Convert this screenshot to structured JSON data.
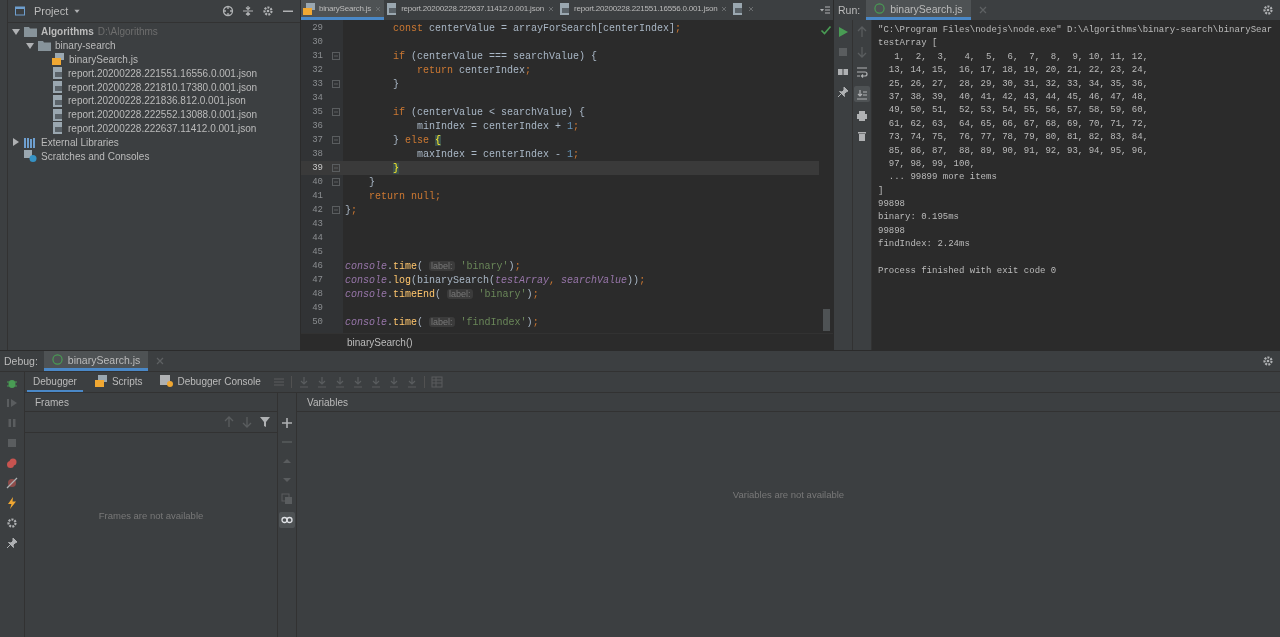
{
  "project": {
    "title": "Project",
    "tree": [
      {
        "name": "Algorithms",
        "hint": "D:\\Algorithms",
        "kind": "folder",
        "expanded": true,
        "children": [
          {
            "name": "binary-search",
            "kind": "folder",
            "expanded": true,
            "children": [
              {
                "name": "binarySearch.js",
                "kind": "js"
              },
              {
                "name": "report.20200228.221551.16556.0.001.json",
                "kind": "json"
              },
              {
                "name": "report.20200228.221810.17380.0.001.json",
                "kind": "json"
              },
              {
                "name": "report.20200228.221836.812.0.001.json",
                "kind": "json"
              },
              {
                "name": "report.20200228.222552.13088.0.001.json",
                "kind": "json"
              },
              {
                "name": "report.20200228.222637.11412.0.001.json",
                "kind": "json"
              }
            ]
          }
        ]
      },
      {
        "name": "External Libraries",
        "kind": "library",
        "expanded": false
      },
      {
        "name": "Scratches and Consoles",
        "kind": "scratches"
      }
    ]
  },
  "editor": {
    "tabs": [
      {
        "label": "binarySearch.js",
        "kind": "js",
        "selected": true
      },
      {
        "label": "report.20200228.222637.11412.0.001.json",
        "kind": "json",
        "selected": false
      },
      {
        "label": "report.20200228.221551.16556.0.001.json",
        "kind": "json",
        "selected": false
      },
      {
        "kind": "json",
        "selected": false
      }
    ],
    "lines": [
      {
        "number": "29",
        "current": false,
        "tokens": [
          {
            "kind": "kw",
            "text": "        const"
          },
          {
            "kind": "plain",
            "text": " centerValue = arrayForSearch[centerIndex]"
          },
          {
            "kind": "kw",
            "text": ";"
          }
        ]
      },
      {
        "number": "30",
        "current": false
      },
      {
        "number": "31",
        "fold": true,
        "current": false,
        "tokens": [
          {
            "kind": "kw",
            "text": "        if"
          },
          {
            "kind": "plain",
            "text": " (centerValue === searchValue) {"
          }
        ]
      },
      {
        "number": "32",
        "current": false,
        "tokens": [
          {
            "kind": "kw",
            "text": "            return"
          },
          {
            "kind": "plain",
            "text": " centerIndex"
          },
          {
            "kind": "kw",
            "text": ";"
          }
        ]
      },
      {
        "number": "33",
        "fold": true,
        "current": false,
        "tokens": [
          {
            "kind": "plain",
            "text": "        }"
          }
        ]
      },
      {
        "number": "34",
        "current": false
      },
      {
        "number": "35",
        "fold": true,
        "current": false,
        "tokens": [
          {
            "kind": "kw",
            "text": "        if"
          },
          {
            "kind": "plain",
            "text": " (centerValue < searchValue) {"
          }
        ]
      },
      {
        "number": "36",
        "current": false,
        "tokens": [
          {
            "kind": "plain",
            "text": "            minIndex = centerIndex + "
          },
          {
            "kind": "num",
            "text": "1"
          },
          {
            "kind": "kw",
            "text": ";"
          }
        ]
      },
      {
        "number": "37",
        "fold": true,
        "current": false,
        "tokens": [
          {
            "kind": "plain",
            "text": "        } "
          },
          {
            "kind": "kw",
            "text": "else "
          },
          {
            "kind": "brace",
            "text": "{"
          }
        ]
      },
      {
        "number": "38",
        "current": false,
        "tokens": [
          {
            "kind": "plain",
            "text": "            maxIndex = centerIndex - "
          },
          {
            "kind": "num",
            "text": "1"
          },
          {
            "kind": "kw",
            "text": ";"
          }
        ]
      },
      {
        "number": "39",
        "fold": true,
        "current": true,
        "tokens": [
          {
            "kind": "brace",
            "text": "        }"
          }
        ]
      },
      {
        "number": "40",
        "fold": true,
        "current": false,
        "tokens": [
          {
            "kind": "plain",
            "text": "    }"
          }
        ]
      },
      {
        "number": "41",
        "current": false,
        "tokens": [
          {
            "kind": "kw",
            "text": "    return null;"
          }
        ]
      },
      {
        "number": "42",
        "fold": true,
        "current": false,
        "tokens": [
          {
            "kind": "plain",
            "text": "}"
          },
          {
            "kind": "kw",
            "text": ";"
          }
        ]
      },
      {
        "number": "43",
        "current": false
      },
      {
        "number": "44",
        "current": false
      },
      {
        "number": "45",
        "current": false
      },
      {
        "number": "46",
        "current": false,
        "tokens": [
          {
            "kind": "global",
            "text": "console"
          },
          {
            "kind": "plain",
            "text": "."
          },
          {
            "kind": "fn",
            "text": "time"
          },
          {
            "kind": "plain",
            "text": "( "
          },
          {
            "kind": "hint",
            "text": "label:"
          },
          {
            "kind": "str",
            "text": " 'binary'"
          },
          {
            "kind": "plain",
            "text": ")"
          },
          {
            "kind": "kw",
            "text": ";"
          }
        ]
      },
      {
        "number": "47",
        "current": false,
        "tokens": [
          {
            "kind": "global",
            "text": "console"
          },
          {
            "kind": "plain",
            "text": "."
          },
          {
            "kind": "fn",
            "text": "log"
          },
          {
            "kind": "plain",
            "text": "(binarySearch("
          },
          {
            "kind": "param",
            "text": "testArray"
          },
          {
            "kind": "kw",
            "text": ", "
          },
          {
            "kind": "param",
            "text": "searchValue"
          },
          {
            "kind": "plain",
            "text": "))"
          },
          {
            "kind": "kw",
            "text": ";"
          }
        ]
      },
      {
        "number": "48",
        "current": false,
        "tokens": [
          {
            "kind": "global",
            "text": "console"
          },
          {
            "kind": "plain",
            "text": "."
          },
          {
            "kind": "fn",
            "text": "timeEnd"
          },
          {
            "kind": "plain",
            "text": "( "
          },
          {
            "kind": "hint",
            "text": "label:"
          },
          {
            "kind": "str",
            "text": " 'binary'"
          },
          {
            "kind": "plain",
            "text": ")"
          },
          {
            "kind": "kw",
            "text": ";"
          }
        ]
      },
      {
        "number": "49",
        "current": false
      },
      {
        "number": "50",
        "current": false,
        "tokens": [
          {
            "kind": "global",
            "text": "console"
          },
          {
            "kind": "plain",
            "text": "."
          },
          {
            "kind": "fn",
            "text": "time"
          },
          {
            "kind": "plain",
            "text": "( "
          },
          {
            "kind": "hint",
            "text": "label:"
          },
          {
            "kind": "str",
            "text": " 'findIndex'"
          },
          {
            "kind": "plain",
            "text": ")"
          },
          {
            "kind": "kw",
            "text": ";"
          }
        ]
      }
    ],
    "breadcrumb": "binarySearch()"
  },
  "run": {
    "label": "Run:",
    "tab": "binarySearch.js",
    "output": [
      [
        "\"C:\\Program Files\\nodejs\\node.exe\" D:\\Algorithms\\binary-search\\binarySear",
        "testArray [",
        "   1,  2,  3,   4,  5,  6,  7,  8,  9, 10, 11, 12,",
        "  13, 14, 15,  16, 17, 18, 19, 20, 21, 22, 23, 24,",
        "  25, 26, 27,  28, 29, 30, 31, 32, 33, 34, 35, 36,",
        "  37, 38, 39,  40, 41, 42, 43, 44, 45, 46, 47, 48,",
        "  49, 50, 51,  52, 53, 54, 55, 56, 57, 58, 59, 60,",
        "  61, 62, 63,  64, 65, 66, 67, 68, 69, 70, 71, 72,",
        "  73, 74, 75,  76, 77, 78, 79, 80, 81, 82, 83, 84,",
        "  85, 86, 87,  88, 89, 90, 91, 92, 93, 94, 95, 96,",
        "  97, 98, 99, 100,",
        "  ... 99899 more items",
        "]",
        "99898",
        "binary: 0.195ms",
        "99898",
        "findIndex: 2.24ms"
      ],
      [
        "Process finished with exit code 0"
      ]
    ]
  },
  "debug": {
    "label": "Debug:",
    "tab": "binarySearch.js",
    "tabs": [
      {
        "label": "Debugger",
        "kind": "plain",
        "selected": true
      },
      {
        "label": "Scripts",
        "kind": "js",
        "selected": false
      },
      {
        "label": "Debugger Console",
        "kind": "console",
        "selected": false
      }
    ],
    "frames": {
      "title": "Frames",
      "message": "Frames are not available"
    },
    "variables": {
      "title": "Variables",
      "message": "Variables are not available"
    }
  }
}
